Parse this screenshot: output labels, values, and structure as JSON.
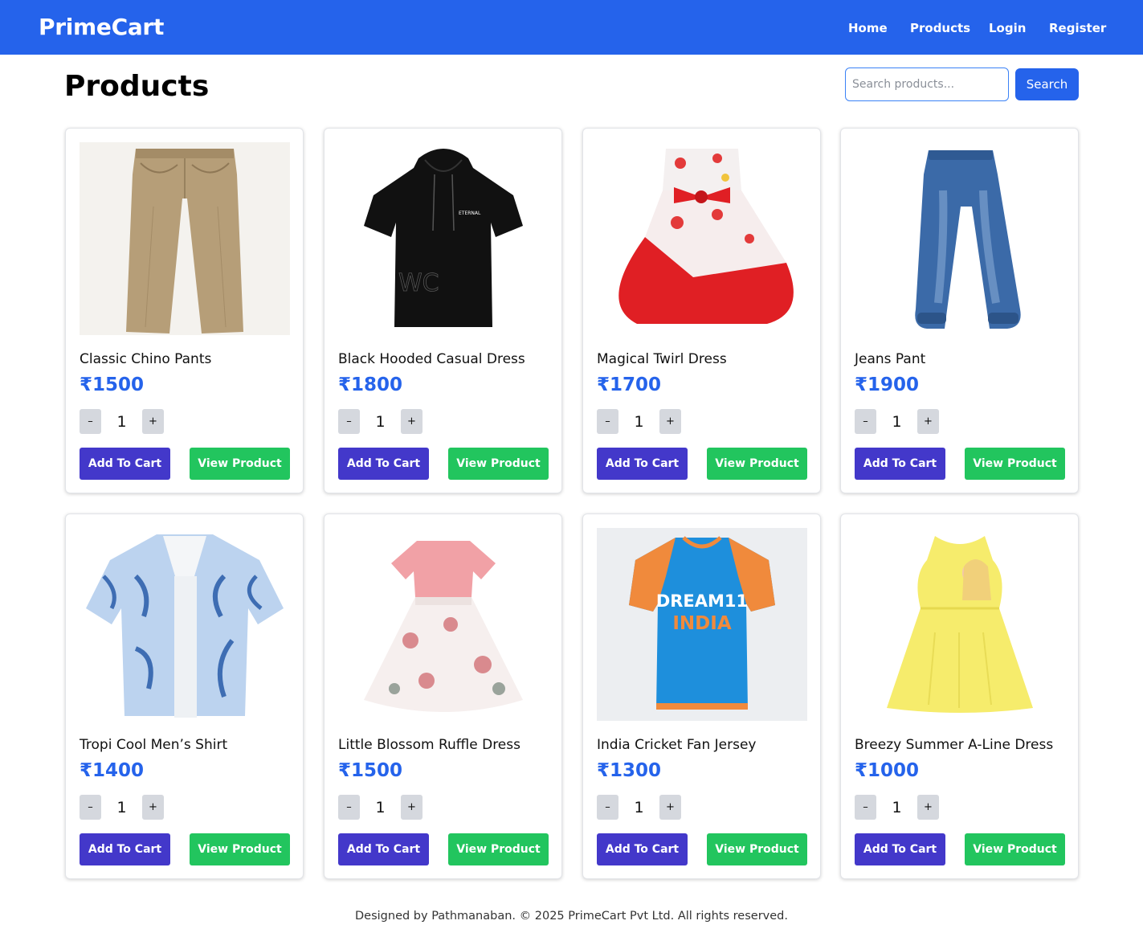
{
  "navbar": {
    "brand": "PrimeCart",
    "links": [
      "Home",
      "Products",
      "Login",
      "Register"
    ],
    "color": "#2563eb"
  },
  "page": {
    "title": "Products",
    "search_placeholder": "Search products...",
    "search_button": "Search"
  },
  "products": [
    {
      "name": "Classic Chino Pants",
      "price": "₹1500",
      "qty": "1",
      "icon": "chino-pants-image"
    },
    {
      "name": "Black Hooded Casual Dress",
      "price": "₹1800",
      "qty": "1",
      "icon": "black-hoodie-image"
    },
    {
      "name": "Magical Twirl Dress",
      "price": "₹1700",
      "qty": "1",
      "icon": "twirl-dress-image"
    },
    {
      "name": "Jeans Pant",
      "price": "₹1900",
      "qty": "1",
      "icon": "jeans-pant-image"
    },
    {
      "name": "Tropi Cool Men’s Shirt",
      "price": "₹1400",
      "qty": "1",
      "icon": "tropical-shirt-image"
    },
    {
      "name": "Little Blossom Ruffle Dress",
      "price": "₹1500",
      "qty": "1",
      "icon": "ruffle-dress-image"
    },
    {
      "name": "India Cricket Fan Jersey",
      "price": "₹1300",
      "qty": "1",
      "icon": "cricket-jersey-image"
    },
    {
      "name": "Breezy Summer A-Line Dress",
      "price": "₹1000",
      "qty": "1",
      "icon": "summer-dress-image"
    }
  ],
  "card_labels": {
    "minus": "–",
    "plus": "+",
    "add_to_cart": "Add To Cart",
    "view_product": "View Product"
  },
  "colors": {
    "price": "#2563eb",
    "add_to_cart": "#4338ca",
    "view_product": "#22c55e",
    "qty_button": "#d5d8de"
  },
  "footer": {
    "text": "Designed by Pathmanaban. © 2025 PrimeCart Pvt Ltd. All rights reserved."
  }
}
